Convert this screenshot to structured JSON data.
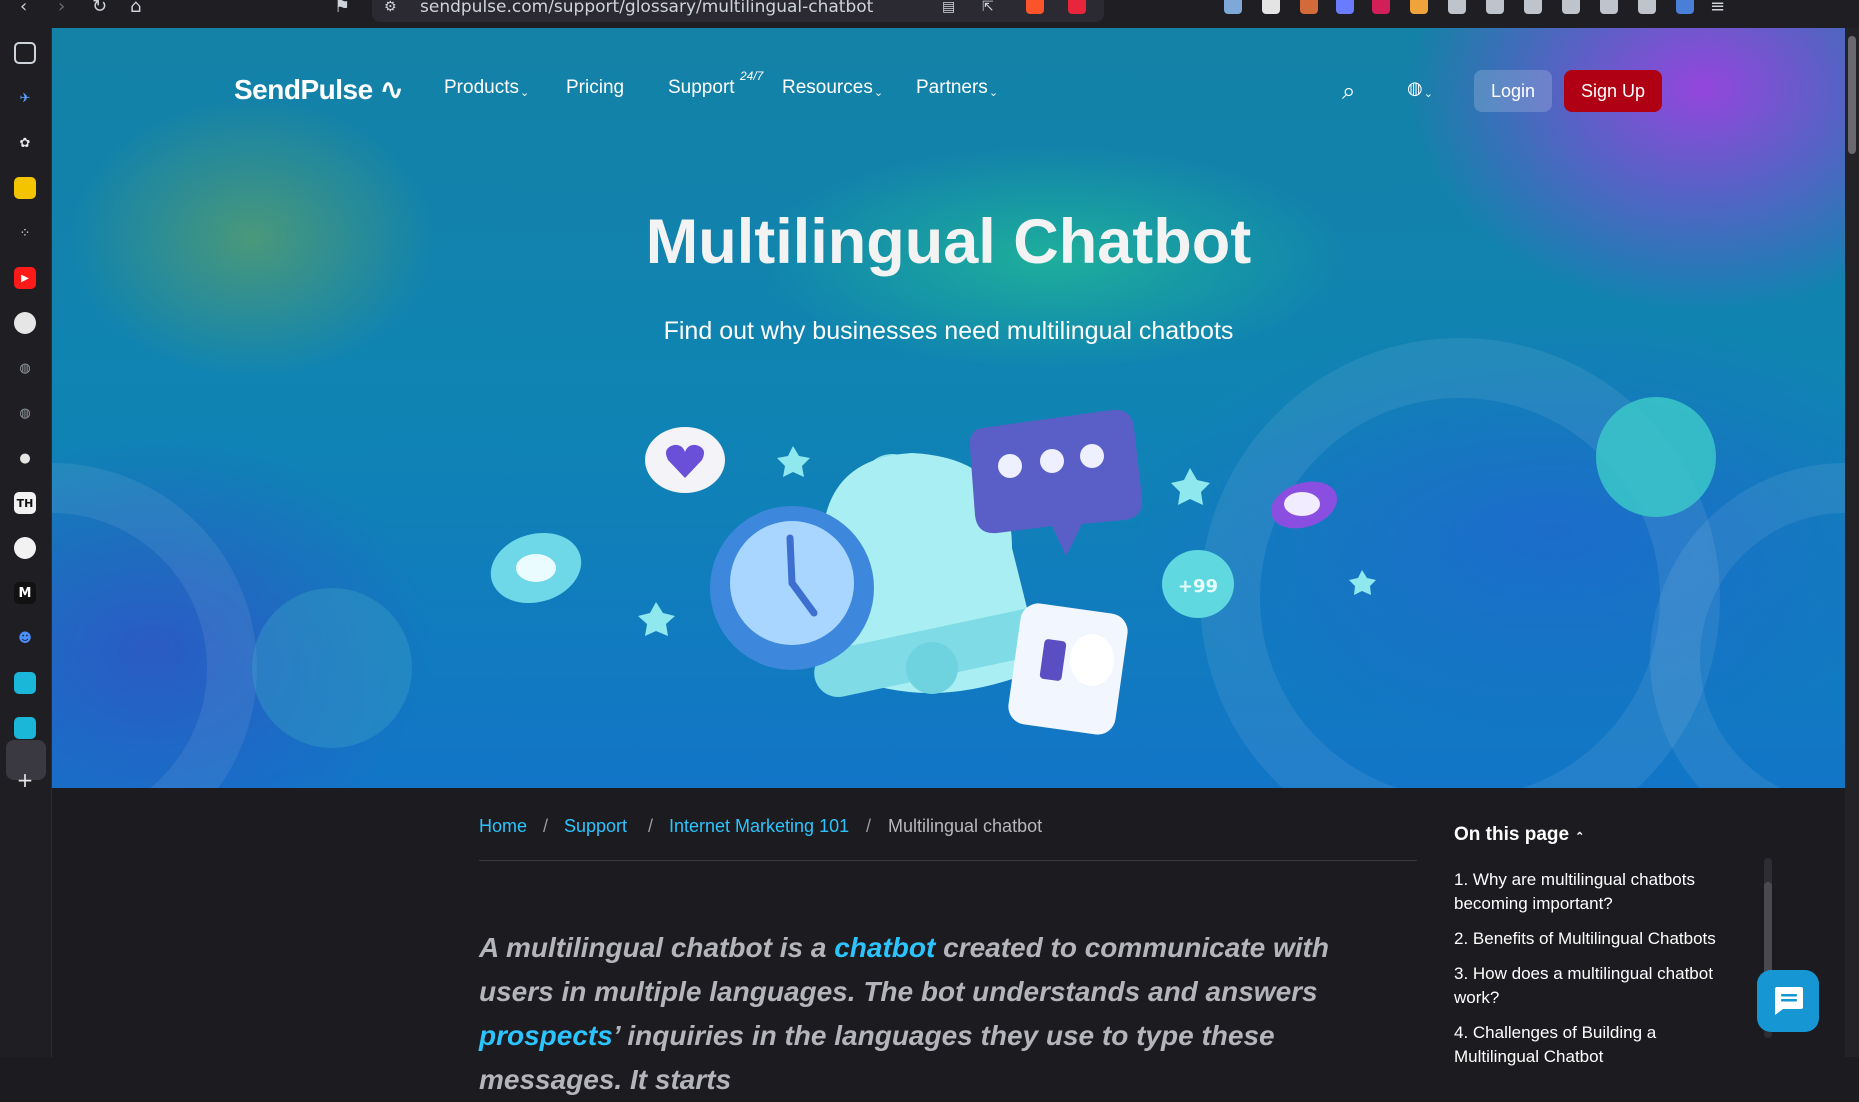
{
  "browser": {
    "url": "sendpulse.com/support/glossary/multilingual-chatbot"
  },
  "sidebar": {
    "icons": [
      "sidebar-toggle-icon",
      "bird-icon",
      "chatgpt-icon",
      "ynab-icon",
      "dots-icon",
      "youtube-icon",
      "github-icon",
      "globe-icon",
      "globe-icon",
      "chat-bubble-icon",
      "th-icon",
      "google-icon",
      "medium-icon",
      "robot-icon",
      "sendpulse-icon",
      "sendpulse-icon",
      "add-icon"
    ],
    "th_label": "TH",
    "medium_label": "M"
  },
  "nav": {
    "logo": "SendPulse",
    "products": "Products",
    "pricing": "Pricing",
    "support": "Support",
    "support_badge": "24/7",
    "resources": "Resources",
    "partners": "Partners",
    "login": "Login",
    "signup": "Sign Up"
  },
  "hero": {
    "title": "Multilingual Chatbot",
    "subtitle": "Find out why businesses need multilingual chatbots",
    "badge": "+99"
  },
  "breadcrumb": {
    "home": "Home",
    "support": "Support",
    "category": "Internet Marketing 101",
    "current": "Multilingual chatbot",
    "separator": "/"
  },
  "article": {
    "lead_1": "A multilingual chatbot is a ",
    "lead_link_1": "chatbot",
    "lead_2": " created to communicate with users in multiple languages. The bot understands and answers ",
    "lead_link_2": "prospects",
    "lead_3": "’ inquiries in the languages they use to type these messages. It starts"
  },
  "toc": {
    "title": "On this page",
    "items": [
      "1. Why are multilingual chatbots becoming important?",
      "2. Benefits of Multilingual Chatbots",
      "3. How does a multilingual chatbot work?",
      "4. Challenges of Building a Multilingual Chatbot"
    ]
  },
  "colors": {
    "accent_link": "#2cc4ff",
    "signup": "#b00014",
    "chat_button": "#1697d3"
  }
}
